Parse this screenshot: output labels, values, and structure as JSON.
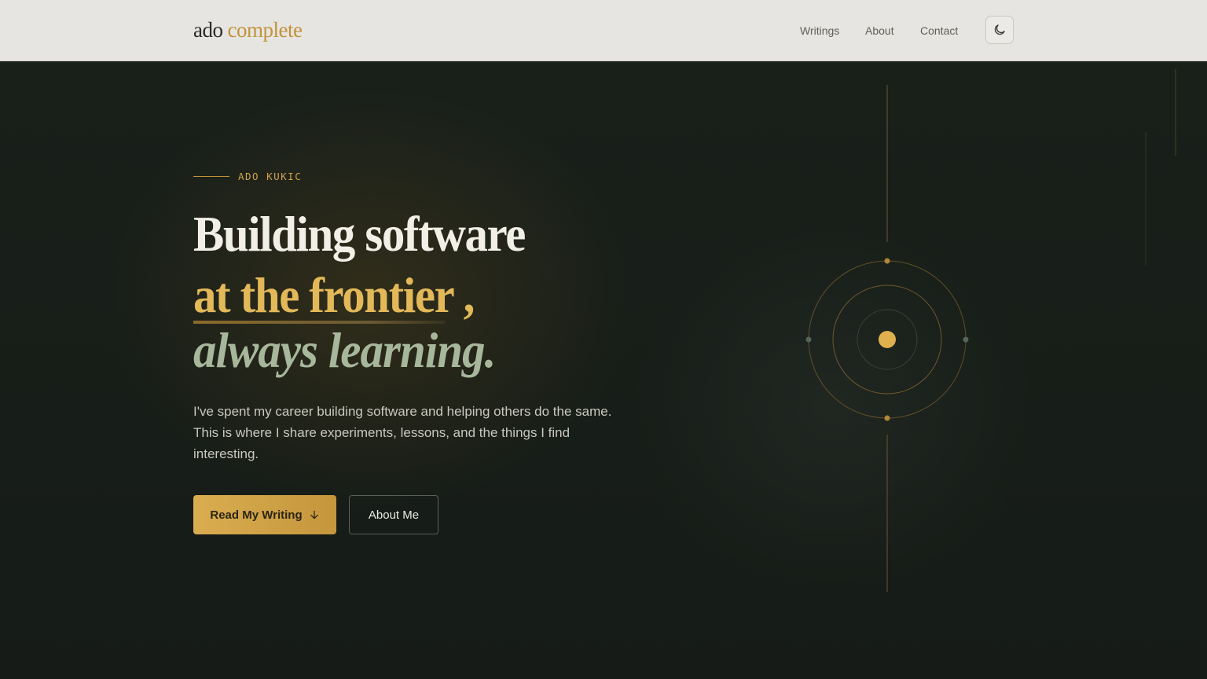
{
  "header": {
    "logo": {
      "part1": "ado",
      "part2": "complete"
    },
    "nav": [
      {
        "label": "Writings"
      },
      {
        "label": "About"
      },
      {
        "label": "Contact"
      }
    ],
    "theme_toggle_icon": "moon-icon"
  },
  "hero": {
    "eyebrow": "ADO KUKIC",
    "headline": {
      "line1": "Building software",
      "line2": "at the frontier ,",
      "line3": "always learning."
    },
    "lead": "I've spent my career building software and helping others do the same. This is where I share experiments, lessons, and the things I find interesting.",
    "primary_button": {
      "label": "Read My Writing",
      "icon": "arrow-down-icon"
    },
    "secondary_button": {
      "label": "About Me"
    }
  },
  "colors": {
    "accent_gold": "#e2b859",
    "sage": "#a7b79c",
    "background": "#171d18",
    "header_bg": "#e6e5e1"
  }
}
